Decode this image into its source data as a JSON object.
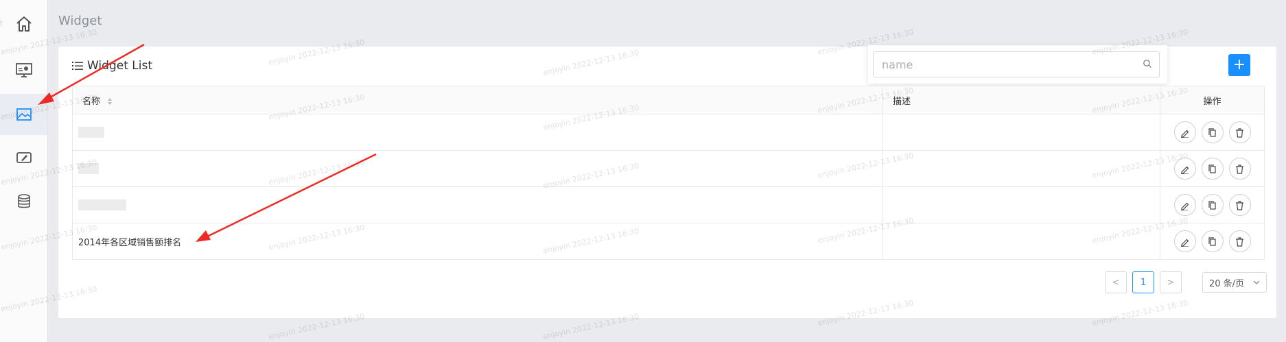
{
  "page": {
    "title": "Widget"
  },
  "sidebar": {
    "items": [
      {
        "name": "home",
        "icon": "home-icon"
      },
      {
        "name": "dashboard",
        "icon": "monitor-icon"
      },
      {
        "name": "widget",
        "icon": "image-icon"
      },
      {
        "name": "editor",
        "icon": "pen-icon"
      },
      {
        "name": "datasource",
        "icon": "database-icon"
      }
    ],
    "active": "widget"
  },
  "card": {
    "title": "Widget List"
  },
  "search": {
    "placeholder": "name",
    "value": ""
  },
  "add_button": {
    "label": "+"
  },
  "table": {
    "columns": [
      "名称",
      "描述",
      "操作"
    ],
    "rows": [
      {
        "name": "",
        "description": ""
      },
      {
        "name": "",
        "description": ""
      },
      {
        "name": "",
        "description": ""
      },
      {
        "name": "2014年各区域销售额排名",
        "description": ""
      }
    ]
  },
  "pagination": {
    "prev": "<",
    "current": "1",
    "next": ">",
    "page_size": "20 条/页"
  },
  "watermark": "enjoyin 2022-12-13 16:30",
  "colors": {
    "accent": "#1890ff",
    "annotation_arrow": "#ee2a24"
  }
}
